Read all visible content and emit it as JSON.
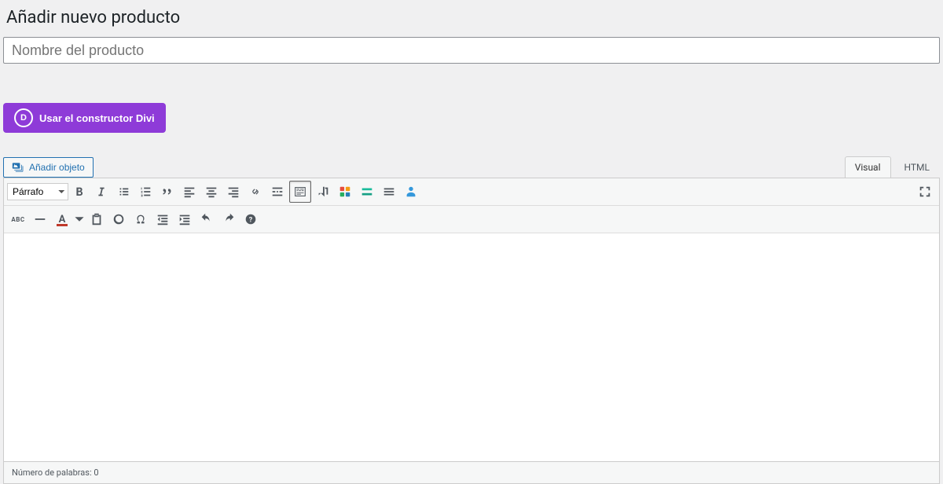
{
  "header": {
    "page_title": "Añadir nuevo producto"
  },
  "title_field": {
    "placeholder": "Nombre del producto"
  },
  "divi": {
    "label": "Usar el constructor Divi",
    "logo_letter": "D"
  },
  "media": {
    "add_object": "Añadir objeto"
  },
  "tabs": {
    "visual": "Visual",
    "html": "HTML"
  },
  "toolbar": {
    "format_select": "Párrafo",
    "abc_label": "ABC"
  },
  "status": {
    "word_count": "Número de palabras: 0"
  }
}
